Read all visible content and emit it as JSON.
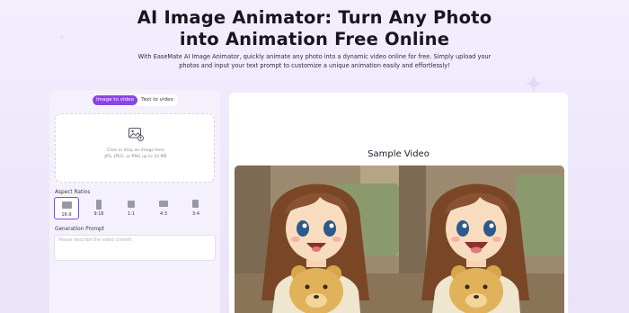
{
  "hero": {
    "title_line1": "AI Image Animator: Turn Any Photo",
    "title_line2": "into Animation Free Online",
    "subtitle_line1": "With EaseMate AI Image Animator, quickly animate any photo into a dynamic video online for free. Simply upload your",
    "subtitle_line2": "photos and input your text prompt to customize a unique animation easily and effortlessly!"
  },
  "tool": {
    "tabs": [
      {
        "label": "Image to video",
        "active": true
      },
      {
        "label": "Text to video",
        "active": false
      }
    ],
    "upload": {
      "icon": "image-upload-icon",
      "line1": "Click or drop an image here",
      "line2": "JPG, JPEG, or PNG up to 10 MB"
    },
    "aspect_ratios_label": "Aspect Ratios",
    "aspect_ratios": [
      {
        "label": "16:9",
        "selected": true
      },
      {
        "label": "9:16",
        "selected": false
      },
      {
        "label": "1:1",
        "selected": false
      },
      {
        "label": "4:3",
        "selected": false
      },
      {
        "label": "3:4",
        "selected": false
      }
    ],
    "prompt_label": "Generation Prompt",
    "prompt_placeholder": "Please describe the video content",
    "prompt_value": ""
  },
  "preview": {
    "title": "Sample Video",
    "frames": [
      {
        "name": "original-image",
        "depicts": "anime-girl-with-teddy-bear"
      },
      {
        "name": "animated-result",
        "depicts": "anime-girl-with-teddy-bear-smiling"
      }
    ]
  },
  "colors": {
    "accent": "#8a45e8",
    "background": "#f0e9fb",
    "panel": "#f5f1fc"
  }
}
